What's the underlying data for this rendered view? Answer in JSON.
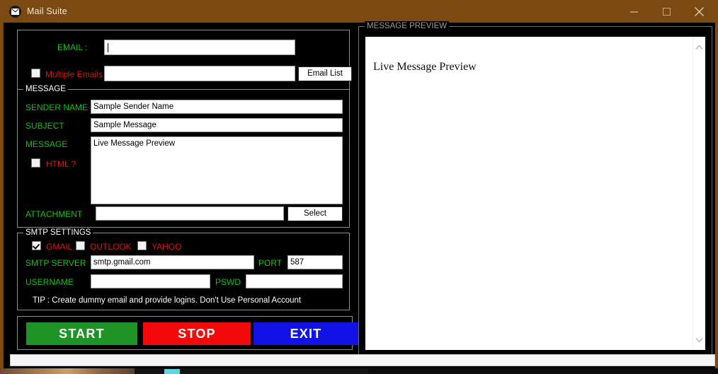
{
  "window": {
    "title": "Mail Suite",
    "icon": "envelope-icon",
    "titlebar_color": "#7a4a12",
    "controls": {
      "minimize": "minimize-icon",
      "maximize": "maximize-icon",
      "close": "close-icon"
    }
  },
  "form": {
    "email": {
      "label": "EMAIL :",
      "value": "",
      "placeholder": ""
    },
    "multiple_emails": {
      "label": "Multiple Emails ?",
      "checked": false,
      "value": "",
      "placeholder": ""
    },
    "email_list_button": "Email List",
    "message_group": "MESSAGE",
    "sender_name": {
      "label": "SENDER NAME",
      "value": "Sample Sender Name"
    },
    "subject": {
      "label": "SUBJECT",
      "value": "Sample Message"
    },
    "message": {
      "label": "MESSAGE",
      "value": "Live Message Preview"
    },
    "html": {
      "label": "HTML ?",
      "checked": false
    },
    "attachment": {
      "label": "ATTACHMENT",
      "value": "",
      "select_button": "Select"
    }
  },
  "smtp": {
    "group_title": "SMTP SETTINGS",
    "providers": [
      {
        "label": "GMAIL",
        "checked": true
      },
      {
        "label": "OUTLOOK",
        "checked": false
      },
      {
        "label": "YAHOO",
        "checked": false
      }
    ],
    "server": {
      "label": "SMTP SERVER",
      "value": "smtp.gmail.com"
    },
    "port": {
      "label": "PORT",
      "value": "587"
    },
    "username": {
      "label": "USERNAME",
      "value": ""
    },
    "password": {
      "label": "PSWD",
      "value": ""
    },
    "tip": "TIP : Create dummy email and provide logins. Don't Use Personal Account"
  },
  "actions": {
    "start": {
      "label": "START",
      "color": "#1f9326"
    },
    "stop": {
      "label": "STOP",
      "color": "#f40a0a"
    },
    "exit": {
      "label": "EXIT",
      "color": "#1212e6"
    }
  },
  "preview": {
    "group_title": "MESSAGE PREVIEW",
    "body_text": "Live Message Preview",
    "scroll_up": "chevron-up-icon",
    "scroll_down": "chevron-down-icon"
  },
  "colors": {
    "label_green": "#12c312",
    "label_red": "#e01010",
    "background": "#000000",
    "accent_brown": "#7a4a12"
  }
}
